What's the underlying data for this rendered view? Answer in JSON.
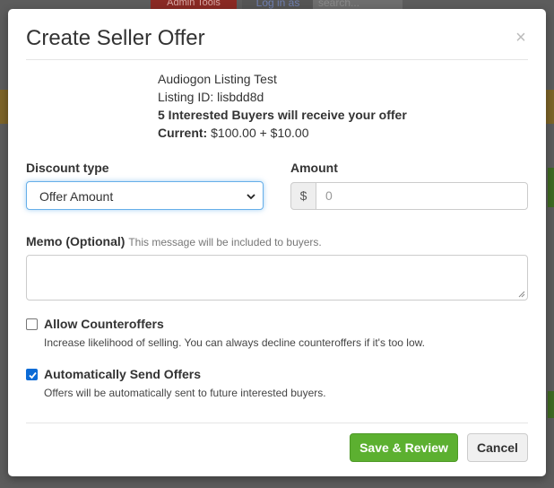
{
  "background": {
    "admin_tools": "Admin Tools",
    "log_in_as": "Log in as",
    "search_placeholder": "search..."
  },
  "modal": {
    "title": "Create Seller Offer",
    "close_symbol": "×"
  },
  "listing": {
    "title": "Audiogon Listing Test",
    "listing_id": "Listing ID: lisbdd8d",
    "interested_buyers": "5 Interested Buyers will receive your offer",
    "current_label": "Current:",
    "current_value": " $100.00 + $10.00"
  },
  "discount": {
    "label": "Discount type",
    "selected": "Offer Amount"
  },
  "amount": {
    "label": "Amount",
    "currency": "$",
    "placeholder": "0"
  },
  "memo": {
    "label": "Memo (Optional)",
    "hint": "This message will be included to buyers."
  },
  "options": {
    "counteroffers": {
      "label": "Allow Counteroffers",
      "help": "Increase likelihood of selling. You can always decline counteroffers if it's too low.",
      "checked": false
    },
    "auto_send": {
      "label": "Automatically Send Offers",
      "help": "Offers will be automatically sent to future interested buyers.",
      "checked": true
    }
  },
  "footer": {
    "save_label": "Save & Review",
    "cancel_label": "Cancel"
  },
  "colors": {
    "save_button": "#5cb030",
    "checkbox_checked": "#0b6bd6",
    "select_focus": "#66afe9"
  }
}
